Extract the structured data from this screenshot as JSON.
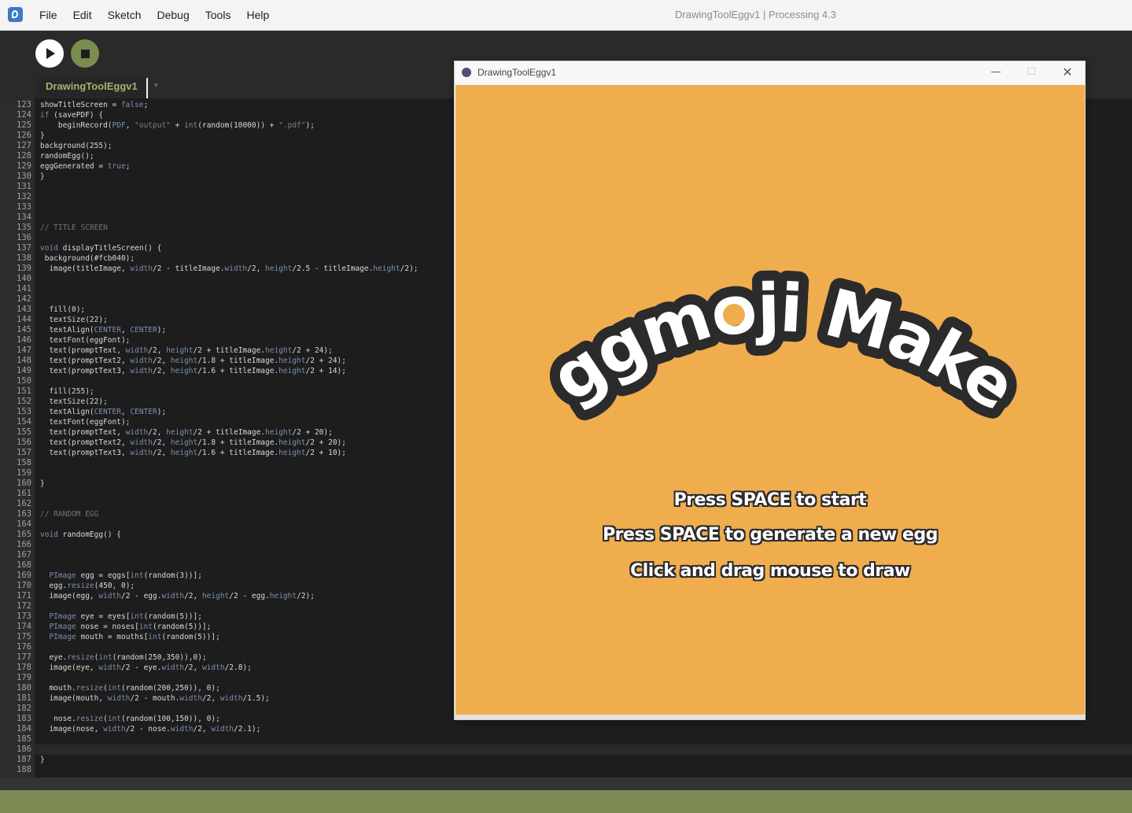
{
  "app": {
    "menu": [
      "File",
      "Edit",
      "Sketch",
      "Debug",
      "Tools",
      "Help"
    ],
    "window_title": "DrawingToolEggv1 | Processing 4.3"
  },
  "toolbar": {
    "run_icon": "play-icon",
    "stop_icon": "stop-icon"
  },
  "tab": {
    "label": "DrawingToolEggv1",
    "menu_glyph": "▾"
  },
  "editor": {
    "first_line": 123,
    "last_line": 188,
    "highlighted_line": 186,
    "lines": [
      {
        "n": 123,
        "code": "showTitleScreen = false;"
      },
      {
        "n": 124,
        "code": "if (savePDF) {"
      },
      {
        "n": 125,
        "code": "    beginRecord(PDF, \"output\" + int(random(10000)) + \".pdf\");"
      },
      {
        "n": 126,
        "code": "}"
      },
      {
        "n": 127,
        "code": "background(255);"
      },
      {
        "n": 128,
        "code": "randomEgg();"
      },
      {
        "n": 129,
        "code": "eggGenerated = true;"
      },
      {
        "n": 130,
        "code": "}"
      },
      {
        "n": 131,
        "code": ""
      },
      {
        "n": 132,
        "code": ""
      },
      {
        "n": 133,
        "code": ""
      },
      {
        "n": 134,
        "code": ""
      },
      {
        "n": 135,
        "code": "// TITLE SCREEN"
      },
      {
        "n": 136,
        "code": ""
      },
      {
        "n": 137,
        "code": "void displayTitleScreen() {"
      },
      {
        "n": 138,
        "code": " background(#fcb040);"
      },
      {
        "n": 139,
        "code": "  image(titleImage, width/2 - titleImage.width/2, height/2.5 - titleImage.height/2);"
      },
      {
        "n": 140,
        "code": ""
      },
      {
        "n": 141,
        "code": ""
      },
      {
        "n": 142,
        "code": ""
      },
      {
        "n": 143,
        "code": "  fill(0);"
      },
      {
        "n": 144,
        "code": "  textSize(22);"
      },
      {
        "n": 145,
        "code": "  textAlign(CENTER, CENTER);"
      },
      {
        "n": 146,
        "code": "  textFont(eggFont);"
      },
      {
        "n": 147,
        "code": "  text(promptText, width/2, height/2 + titleImage.height/2 + 24);"
      },
      {
        "n": 148,
        "code": "  text(promptText2, width/2, height/1.8 + titleImage.height/2 + 24);"
      },
      {
        "n": 149,
        "code": "  text(promptText3, width/2, height/1.6 + titleImage.height/2 + 14);"
      },
      {
        "n": 150,
        "code": ""
      },
      {
        "n": 151,
        "code": "  fill(255);"
      },
      {
        "n": 152,
        "code": "  textSize(22);"
      },
      {
        "n": 153,
        "code": "  textAlign(CENTER, CENTER);"
      },
      {
        "n": 154,
        "code": "  textFont(eggFont);"
      },
      {
        "n": 155,
        "code": "  text(promptText, width/2, height/2 + titleImage.height/2 + 20);"
      },
      {
        "n": 156,
        "code": "  text(promptText2, width/2, height/1.8 + titleImage.height/2 + 20);"
      },
      {
        "n": 157,
        "code": "  text(promptText3, width/2, height/1.6 + titleImage.height/2 + 10);"
      },
      {
        "n": 158,
        "code": ""
      },
      {
        "n": 159,
        "code": ""
      },
      {
        "n": 160,
        "code": "}"
      },
      {
        "n": 161,
        "code": ""
      },
      {
        "n": 162,
        "code": ""
      },
      {
        "n": 163,
        "code": "// RANDOM EGG"
      },
      {
        "n": 164,
        "code": ""
      },
      {
        "n": 165,
        "code": "void randomEgg() {"
      },
      {
        "n": 166,
        "code": ""
      },
      {
        "n": 167,
        "code": ""
      },
      {
        "n": 168,
        "code": ""
      },
      {
        "n": 169,
        "code": "  PImage egg = eggs[int(random(3))];"
      },
      {
        "n": 170,
        "code": "  egg.resize(450, 0);"
      },
      {
        "n": 171,
        "code": "  image(egg, width/2 - egg.width/2, height/2 - egg.height/2);"
      },
      {
        "n": 172,
        "code": ""
      },
      {
        "n": 173,
        "code": "  PImage eye = eyes[int(random(5))];"
      },
      {
        "n": 174,
        "code": "  PImage nose = noses[int(random(5))];"
      },
      {
        "n": 175,
        "code": "  PImage mouth = mouths[int(random(5))];"
      },
      {
        "n": 176,
        "code": ""
      },
      {
        "n": 177,
        "code": "  eye.resize(int(random(250,350)),0);"
      },
      {
        "n": 178,
        "code": "  image(eye, width/2 - eye.width/2, width/2.8);"
      },
      {
        "n": 179,
        "code": ""
      },
      {
        "n": 180,
        "code": "  mouth.resize(int(random(200,250)), 0);"
      },
      {
        "n": 181,
        "code": "  image(mouth, width/2 - mouth.width/2, width/1.5);"
      },
      {
        "n": 182,
        "code": ""
      },
      {
        "n": 183,
        "code": "   nose.resize(int(random(100,150)), 0);"
      },
      {
        "n": 184,
        "code": "  image(nose, width/2 - nose.width/2, width/2.1);"
      },
      {
        "n": 185,
        "code": ""
      },
      {
        "n": 186,
        "code": ""
      },
      {
        "n": 187,
        "code": "}"
      },
      {
        "n": 188,
        "code": ""
      }
    ]
  },
  "sketch": {
    "title": "DrawingToolEggv1",
    "window_controls": {
      "minimize": "—",
      "maximize": "☐",
      "close": "✕"
    },
    "canvas_bg": "#f0ad4e",
    "logo_text": "Eggmoji Maker",
    "prompts": [
      "Press SPACE to start",
      "Press SPACE to generate a new egg",
      "Click and drag mouse to draw"
    ]
  },
  "colors": {
    "accent": "#7d8a54",
    "tab_text": "#a6b36f"
  }
}
